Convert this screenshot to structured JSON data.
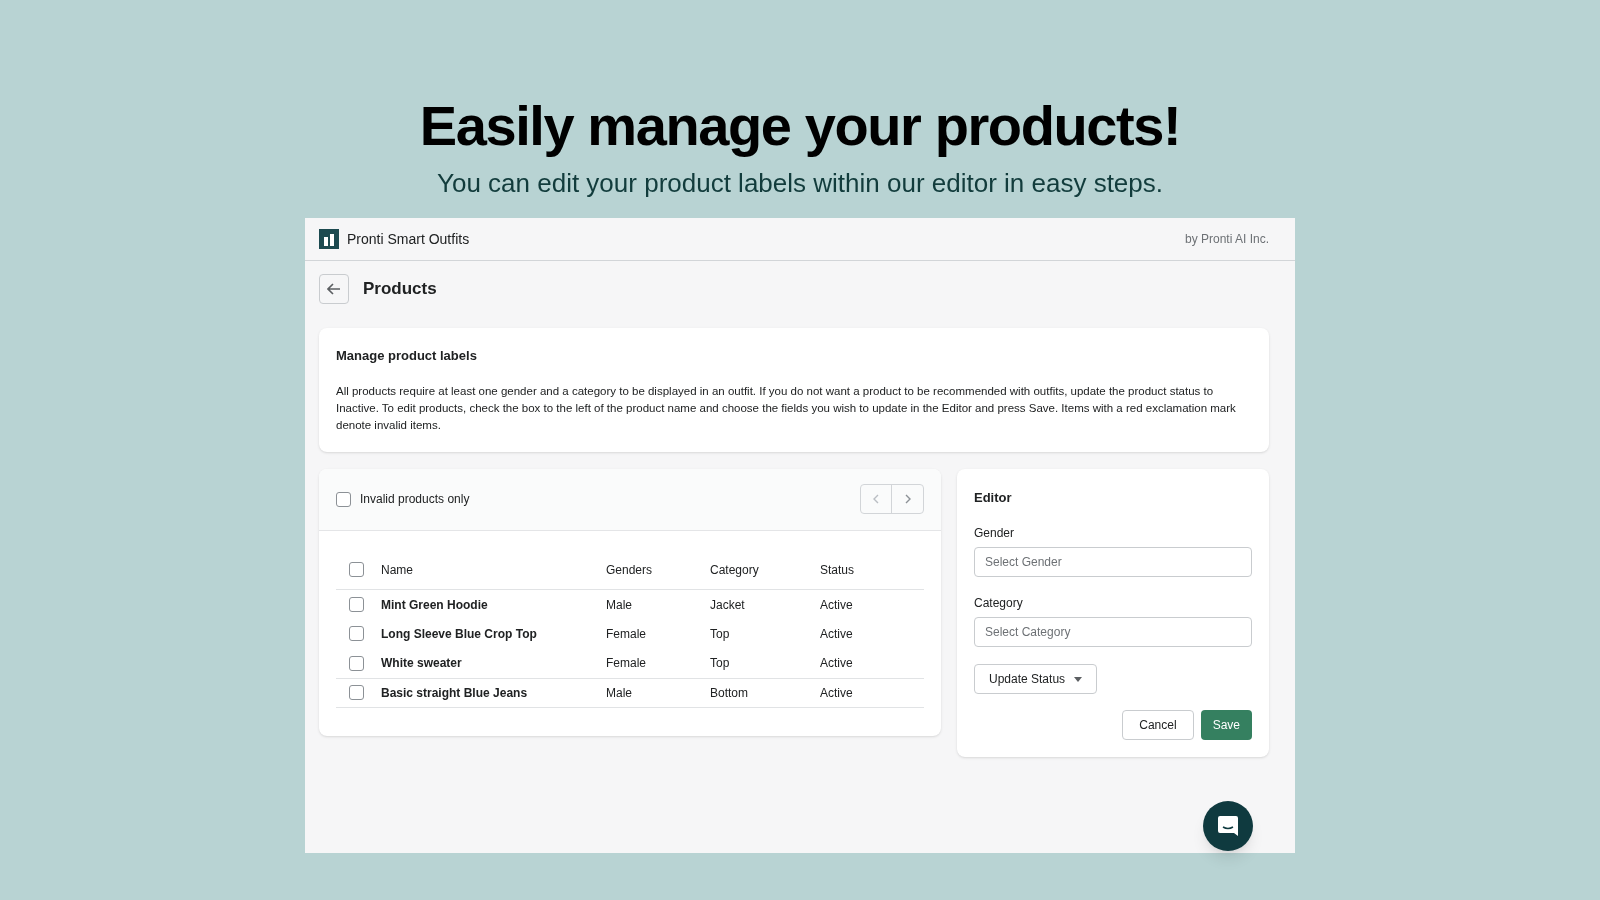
{
  "headline": "Easily manage your products!",
  "subheadline": "You can edit your product labels within our editor in easy steps.",
  "app": {
    "title": "Pronti Smart Outfits",
    "vendor": "by Pronti AI Inc."
  },
  "page_title": "Products",
  "info_card": {
    "title": "Manage product labels",
    "text": "All products require at least one gender and a category to be displayed in an outfit. If you do not want a product to be recommended with outfits, update the product status to Inactive. To edit products, check the box to the left of the product name and choose the fields you wish to update in the Editor and press Save. Items with a red exclamation mark denote invalid items."
  },
  "filter": {
    "label": "Invalid products only",
    "checked": false
  },
  "table": {
    "select_all_checked": false,
    "columns": [
      "Name",
      "Genders",
      "Category",
      "Status"
    ],
    "rows": [
      {
        "checked": false,
        "cells": [
          "Mint Green Hoodie",
          "Male",
          "Jacket",
          "Active"
        ]
      },
      {
        "checked": false,
        "cells": [
          "Long Sleeve Blue Crop Top",
          "Female",
          "Top",
          "Active"
        ]
      },
      {
        "checked": false,
        "cells": [
          "White sweater",
          "Female",
          "Top",
          "Active"
        ]
      },
      {
        "checked": false,
        "cells": [
          "Basic straight Blue Jeans",
          "Male",
          "Bottom",
          "Active"
        ]
      }
    ]
  },
  "editor": {
    "title": "Editor",
    "fields": [
      {
        "label": "Gender",
        "placeholder": "Select Gender"
      },
      {
        "label": "Category",
        "placeholder": "Select Category"
      }
    ],
    "status_button": "Update Status",
    "cancel": "Cancel",
    "save": "Save"
  }
}
